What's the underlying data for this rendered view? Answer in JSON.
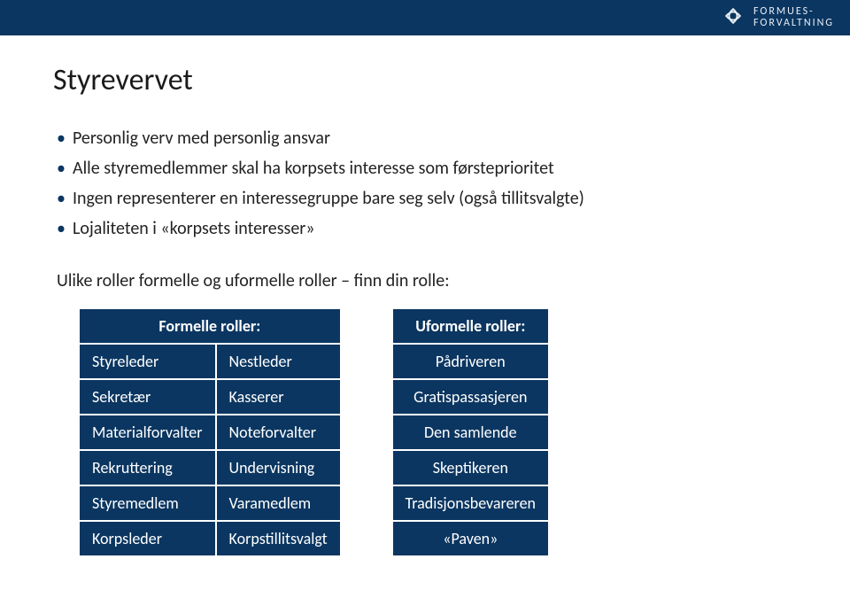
{
  "brand": {
    "line1": "FORMUES-",
    "line2": "FORVALTNING"
  },
  "title": "Styrevervet",
  "bullets": [
    "Personlig verv med personlig ansvar",
    "Alle styremedlemmer skal ha korpsets interesse som førsteprioritet",
    "Ingen representerer en interessegruppe bare seg selv (også tillitsvalgte)",
    "Lojaliteten i «korpsets interesser»"
  ],
  "subtitle": "Ulike roller formelle og uformelle roller – finn din rolle:",
  "formal": {
    "header": "Formelle roller:",
    "rows": [
      [
        "Styreleder",
        "Nestleder"
      ],
      [
        "Sekretær",
        "Kasserer"
      ],
      [
        "Materialforvalter",
        "Noteforvalter"
      ],
      [
        "Rekruttering",
        "Undervisning"
      ],
      [
        "Styremedlem",
        "Varamedlem"
      ],
      [
        "Korpsleder",
        "Korpstillitsvalgt"
      ]
    ]
  },
  "informal": {
    "header": "Uformelle roller:",
    "rows": [
      "Pådriveren",
      "Gratispassasjeren",
      "Den samlende",
      "Skeptikeren",
      "Tradisjonsbevareren",
      "«Paven»"
    ]
  }
}
